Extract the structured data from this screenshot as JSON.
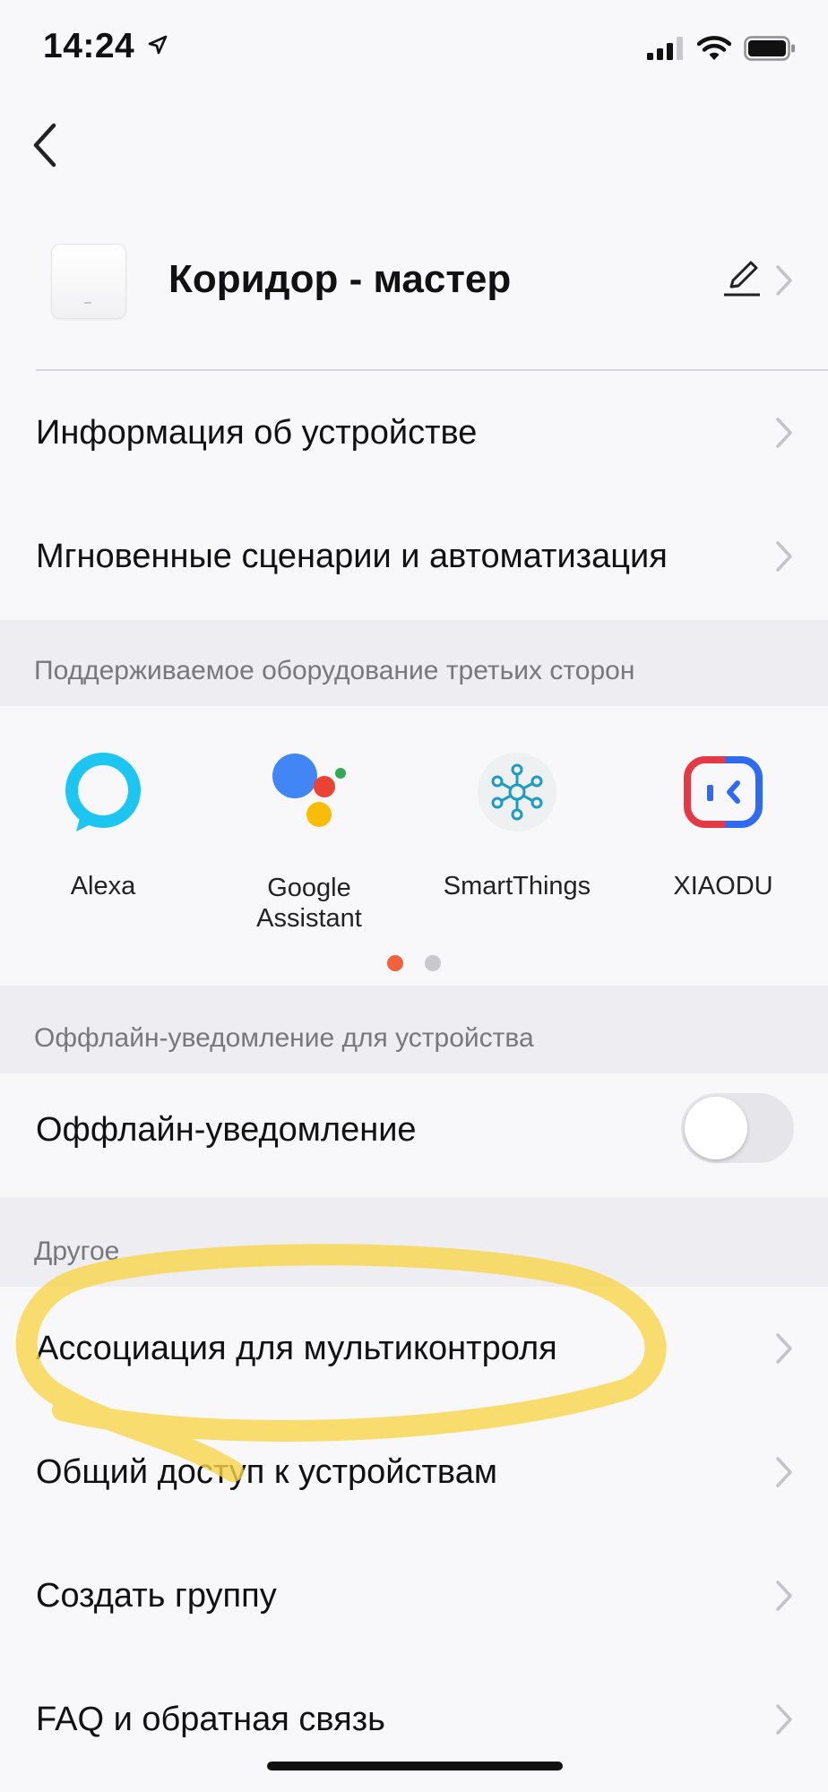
{
  "status_bar": {
    "time": "14:24"
  },
  "device": {
    "name": "Коридор - мастер"
  },
  "rows_top": [
    {
      "label": "Информация об устройстве"
    },
    {
      "label": "Мгновенные сценарии и автоматизация"
    }
  ],
  "third_party": {
    "header": "Поддерживаемое оборудование третьих сторон",
    "items": [
      {
        "label": "Alexa",
        "icon": "alexa-icon"
      },
      {
        "label": "Google Assistant",
        "icon": "google-assistant-icon"
      },
      {
        "label": "SmartThings",
        "icon": "smartthings-icon"
      },
      {
        "label": "XIAODU",
        "icon": "xiaodu-icon"
      }
    ],
    "pages": 2,
    "active_page": 1
  },
  "offline": {
    "header": "Оффлайн-уведомление для устройства",
    "label": "Оффлайн-уведомление",
    "enabled": false
  },
  "other": {
    "header": "Другое",
    "rows": [
      {
        "label": "Ассоциация для мультиконтроля"
      },
      {
        "label": "Общий доступ к устройствам"
      },
      {
        "label": "Создать группу"
      },
      {
        "label": "FAQ и обратная связь"
      }
    ]
  },
  "colors": {
    "page_dot_active": "#F0623B",
    "page_dot_inactive": "#C9C9CD",
    "highlight": "#F8D44A",
    "alexa": "#1CC6F1"
  }
}
